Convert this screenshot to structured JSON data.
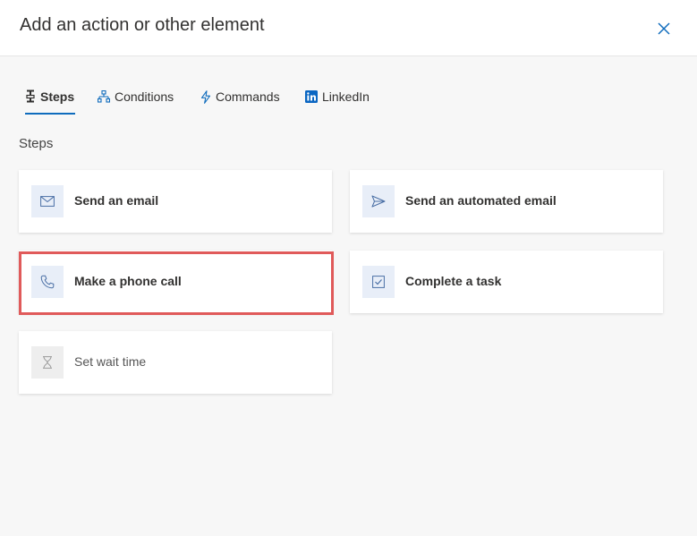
{
  "dialog": {
    "title": "Add an action or other element",
    "close_icon": "close-icon"
  },
  "tabs": [
    {
      "label": "Steps",
      "icon": "steps-icon",
      "active": true
    },
    {
      "label": "Conditions",
      "icon": "conditions-icon",
      "active": false
    },
    {
      "label": "Commands",
      "icon": "lightning-icon",
      "active": false
    },
    {
      "label": "LinkedIn",
      "icon": "linkedin-icon",
      "active": false
    }
  ],
  "section": {
    "label": "Steps"
  },
  "cards": [
    {
      "label": "Send an email",
      "icon": "mail-icon"
    },
    {
      "label": "Send an automated email",
      "icon": "send-icon"
    },
    {
      "label": "Make a phone call",
      "icon": "phone-icon",
      "highlighted": true
    },
    {
      "label": "Complete a task",
      "icon": "checkbox-icon"
    },
    {
      "label": "Set wait time",
      "icon": "hourglass-icon",
      "disabled": true
    }
  ],
  "colors": {
    "accent": "#0f6cbd",
    "highlight_border": "#e05a5a",
    "icon_bg": "#e8eef8",
    "panel_bg": "#f7f7f7"
  }
}
